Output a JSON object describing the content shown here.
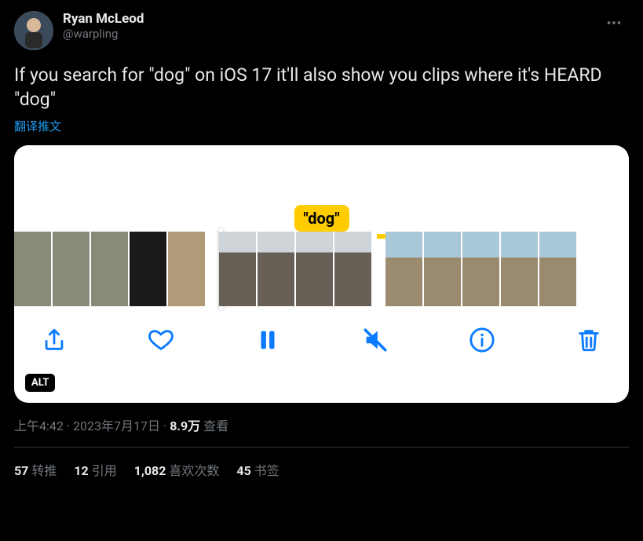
{
  "author": {
    "display_name": "Ryan McLeod",
    "handle": "@warpling"
  },
  "body": "If you search for \"dog\" on iOS 17 it'll also show you clips where it's HEARD \"dog\"",
  "translate_label": "翻译推文",
  "media": {
    "caption_badge": "\"dog\"",
    "alt_label": "ALT"
  },
  "meta": {
    "time": "上午4:42",
    "date": "2023年7月17日",
    "views_num": "8.9万",
    "views_label": "查看"
  },
  "stats": {
    "retweets": {
      "num": "57",
      "label": "转推"
    },
    "quotes": {
      "num": "12",
      "label": "引用"
    },
    "likes": {
      "num": "1,082",
      "label": "喜欢次数"
    },
    "bookmarks": {
      "num": "45",
      "label": "书签"
    }
  }
}
